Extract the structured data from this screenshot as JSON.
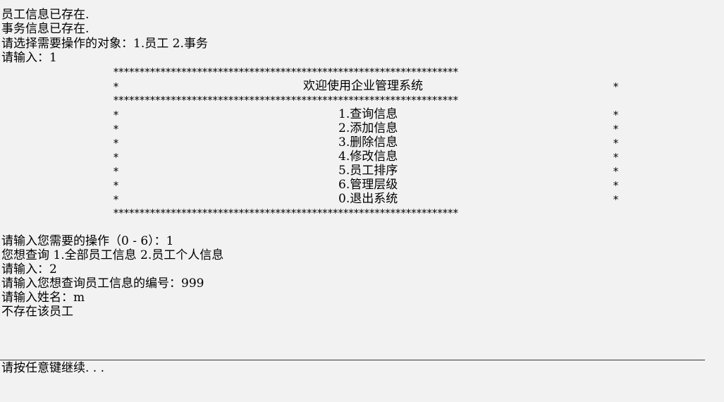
{
  "console": {
    "pre_lines": [
      "员工信息已存在.",
      "事务信息已存在.",
      "请选择需要操作的对象：1.员工 2.事务",
      "请输入：1"
    ],
    "menu": {
      "border": "******************************************************************",
      "edge": "*",
      "title": "欢迎使用企业管理系统",
      "items": [
        "1.查询信息",
        "2.添加信息",
        "3.删除信息",
        "4.修改信息",
        "5.员工排序",
        "6.管理层级",
        "0.退出系统"
      ]
    },
    "post_lines": [
      "请输入您需要的操作（0 - 6）：1",
      "您想查询 1.全部员工信息 2.员工个人信息",
      "请输入：2",
      "请输入您想查询员工信息的编号：999",
      "请输入姓名：m",
      "不存在该员工"
    ],
    "prompt": "请按任意键继续. . ."
  },
  "colors": {
    "background": "#f2f2f2",
    "text": "#000000"
  }
}
